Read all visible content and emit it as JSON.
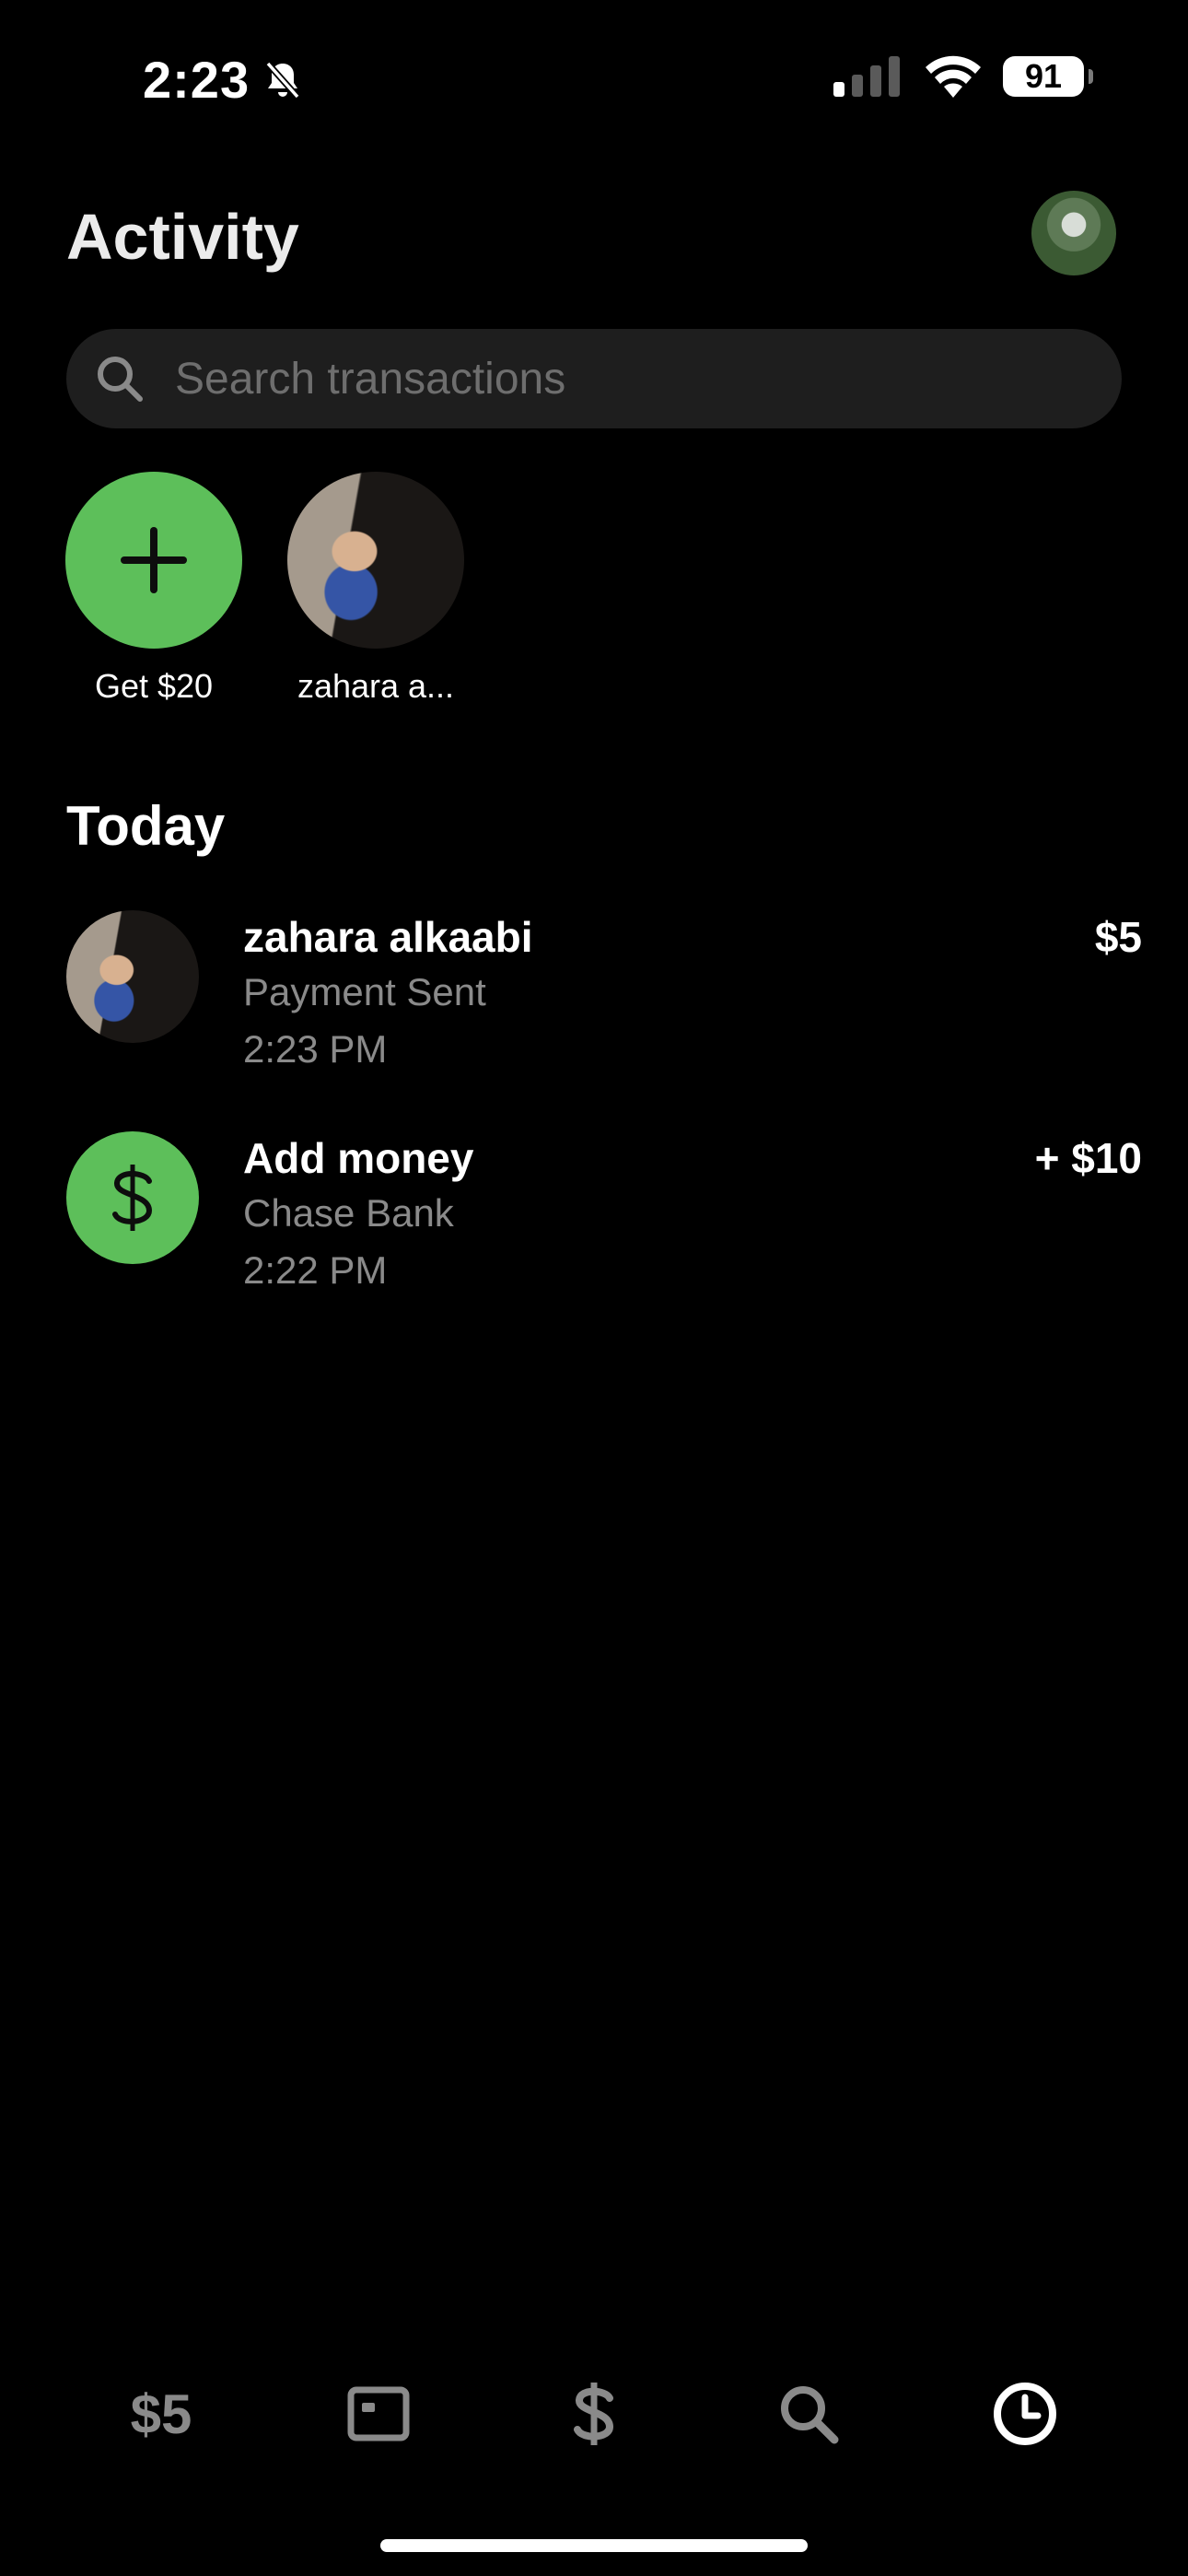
{
  "status_bar": {
    "time": "2:23",
    "battery": "91"
  },
  "header": {
    "title": "Activity"
  },
  "search": {
    "placeholder": "Search transactions"
  },
  "quick_contacts": [
    {
      "label": "Get $20",
      "icon": "plus-icon"
    },
    {
      "label": "zahara a..."
    }
  ],
  "today": {
    "title": "Today",
    "transactions": [
      {
        "name": "zahara alkaabi",
        "subtitle": "Payment Sent",
        "time": "2:23 PM",
        "amount": "$5"
      },
      {
        "name": "Add money",
        "subtitle": "Chase Bank",
        "time": "2:22 PM",
        "amount": "+ $10",
        "icon": "dollar-icon"
      }
    ]
  },
  "tab_bar": {
    "balance_label": "$5",
    "tabs": [
      "balance",
      "card-icon",
      "dollar-icon",
      "search-icon",
      "clock-icon"
    ],
    "active_tab": "clock-icon"
  },
  "colors": {
    "background": "#000000",
    "accent_green": "#5dbf5a",
    "secondary_text": "#8a8a8a",
    "search_bg": "#1e1e1e"
  }
}
